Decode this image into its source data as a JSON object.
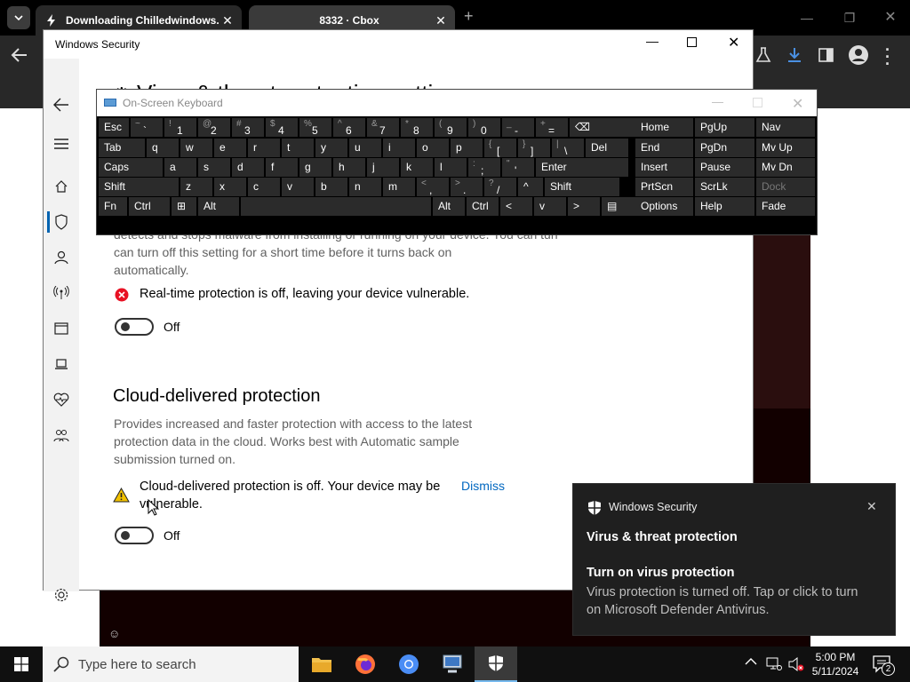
{
  "browser": {
    "tabs": [
      {
        "title": "Downloading Chilledwindows.",
        "close": "✕"
      },
      {
        "title": "8332 · Cbox",
        "close": "✕"
      }
    ],
    "new_tab": "+"
  },
  "windows_security": {
    "title": "Windows Security",
    "page_title_partial": "Virus & threat protection settings",
    "realtime": {
      "desc": "detects and stops malware from installing or running on your device. You can turn off this setting for a short time before it turns back on automatically.",
      "desc_line2": "can turn off this setting for a short time before it turns back on",
      "desc_line3": "automatically.",
      "warning": "Real-time protection is off, leaving your device vulnerable.",
      "toggle_label": "Off"
    },
    "cloud": {
      "heading": "Cloud-delivered protection",
      "desc_line1": "Provides increased and faster protection with access to the latest",
      "desc_line2": "protection data in the cloud. Works best with Automatic sample",
      "desc_line3": "submission turned on.",
      "warning_line1": "Cloud-delivered protection is off. Your device may be",
      "warning_line2": "vulnerable.",
      "dismiss": "Dismiss",
      "toggle_label": "Off"
    }
  },
  "osk": {
    "title": "On-Screen Keyboard",
    "rows": [
      [
        {
          "main": "Esc"
        },
        {
          "sub": "~",
          "main": "`"
        },
        {
          "sub": "!",
          "main": "1"
        },
        {
          "sub": "@",
          "main": "2"
        },
        {
          "sub": "#",
          "main": "3"
        },
        {
          "sub": "$",
          "main": "4"
        },
        {
          "sub": "%",
          "main": "5"
        },
        {
          "sub": "^",
          "main": "6"
        },
        {
          "sub": "&",
          "main": "7"
        },
        {
          "sub": "*",
          "main": "8"
        },
        {
          "sub": "(",
          "main": "9"
        },
        {
          "sub": ")",
          "main": "0"
        },
        {
          "sub": "_",
          "main": "-"
        },
        {
          "sub": "+",
          "main": "="
        },
        {
          "main": "⌫"
        }
      ],
      [
        {
          "main": "Tab"
        },
        {
          "main": "q"
        },
        {
          "main": "w"
        },
        {
          "main": "e"
        },
        {
          "main": "r"
        },
        {
          "main": "t"
        },
        {
          "main": "y"
        },
        {
          "main": "u"
        },
        {
          "main": "i"
        },
        {
          "main": "o"
        },
        {
          "main": "p"
        },
        {
          "sub": "{",
          "main": "["
        },
        {
          "sub": "}",
          "main": "]"
        },
        {
          "sub": "|",
          "main": "\\"
        },
        {
          "main": "Del"
        }
      ],
      [
        {
          "main": "Caps"
        },
        {
          "main": "a"
        },
        {
          "main": "s"
        },
        {
          "main": "d"
        },
        {
          "main": "f"
        },
        {
          "main": "g"
        },
        {
          "main": "h"
        },
        {
          "main": "j"
        },
        {
          "main": "k"
        },
        {
          "main": "l"
        },
        {
          "sub": ":",
          "main": ";"
        },
        {
          "sub": "\"",
          "main": "'"
        },
        {
          "main": "Enter"
        }
      ],
      [
        {
          "main": "Shift"
        },
        {
          "main": "z"
        },
        {
          "main": "x"
        },
        {
          "main": "c"
        },
        {
          "main": "v"
        },
        {
          "main": "b"
        },
        {
          "main": "n"
        },
        {
          "main": "m"
        },
        {
          "sub": "<",
          "main": ","
        },
        {
          "sub": ">",
          "main": "."
        },
        {
          "sub": "?",
          "main": "/"
        },
        {
          "main": "^"
        },
        {
          "main": "Shift"
        }
      ],
      [
        {
          "main": "Fn"
        },
        {
          "main": "Ctrl"
        },
        {
          "main": "⊞"
        },
        {
          "main": "Alt"
        },
        {
          "main": ""
        },
        {
          "main": "Alt"
        },
        {
          "main": "Ctrl"
        },
        {
          "main": "<"
        },
        {
          "main": "v"
        },
        {
          "main": ">"
        },
        {
          "main": "▤"
        }
      ]
    ],
    "right": [
      [
        "Home",
        "PgUp",
        "Nav"
      ],
      [
        "End",
        "PgDn",
        "Mv Up"
      ],
      [
        "Insert",
        "Pause",
        "Mv Dn"
      ],
      [
        "PrtScn",
        "ScrLk",
        "Dock"
      ],
      [
        "Options",
        "Help",
        "Fade"
      ]
    ]
  },
  "toast": {
    "app": "Windows Security",
    "close": "✕",
    "heading": "Virus & threat protection",
    "title": "Turn on virus protection",
    "body_line1": "Virus protection is turned off. Tap or click to turn",
    "body_line2": "on Microsoft Defender Antivirus."
  },
  "taskbar": {
    "search_placeholder": "Type here to search",
    "time": "5:00 PM",
    "date": "5/11/2024",
    "notification_count": "2"
  },
  "colors": {
    "accent": "#0063b1",
    "link": "#0067c0",
    "error_red": "#e81123",
    "warn_yellow": "#f0c000"
  }
}
